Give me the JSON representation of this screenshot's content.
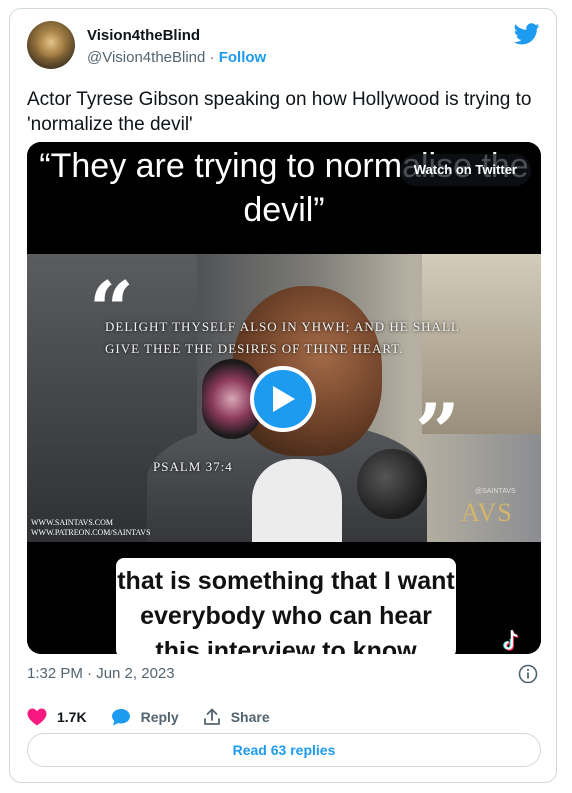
{
  "author": {
    "name": "Vision4theBlind",
    "handle": "@Vision4theBlind",
    "separator": " · ",
    "follow_label": "Follow"
  },
  "tweet": {
    "text": "Actor Tyrese Gibson speaking on how Hollywood is trying to 'normalize the devil'"
  },
  "media": {
    "top_caption": "“They are trying to normalise the devil”",
    "watch_label": "Watch on Twitter",
    "quote_open": "“",
    "quote_close": "”",
    "verse": "Delight thyself also in YHWH; and he shall give thee the desires of thine heart.",
    "psalm": "Psalm 37:4",
    "website_1": "WWW.SAINTAVS.COM",
    "website_2": "WWW.PATREON.COM/SAINTAVS",
    "avs_handle": "@SAINTAVS",
    "avs_logo": "AVS",
    "bottom_caption": "that is something that I want everybody who can hear this interview to know"
  },
  "meta": {
    "timestamp": "1:32 PM · Jun 2, 2023"
  },
  "actions": {
    "likes": "1.7K",
    "reply_label": "Reply",
    "share_label": "Share"
  },
  "replies_button": "Read 63 replies",
  "colors": {
    "accent": "#1d9bf0",
    "like": "#f91880",
    "muted": "#536471",
    "border": "#cfd9de"
  },
  "icons": [
    "twitter-bird-icon",
    "play-icon",
    "info-icon",
    "heart-icon",
    "reply-bubble-icon",
    "share-icon",
    "tiktok-icon"
  ]
}
